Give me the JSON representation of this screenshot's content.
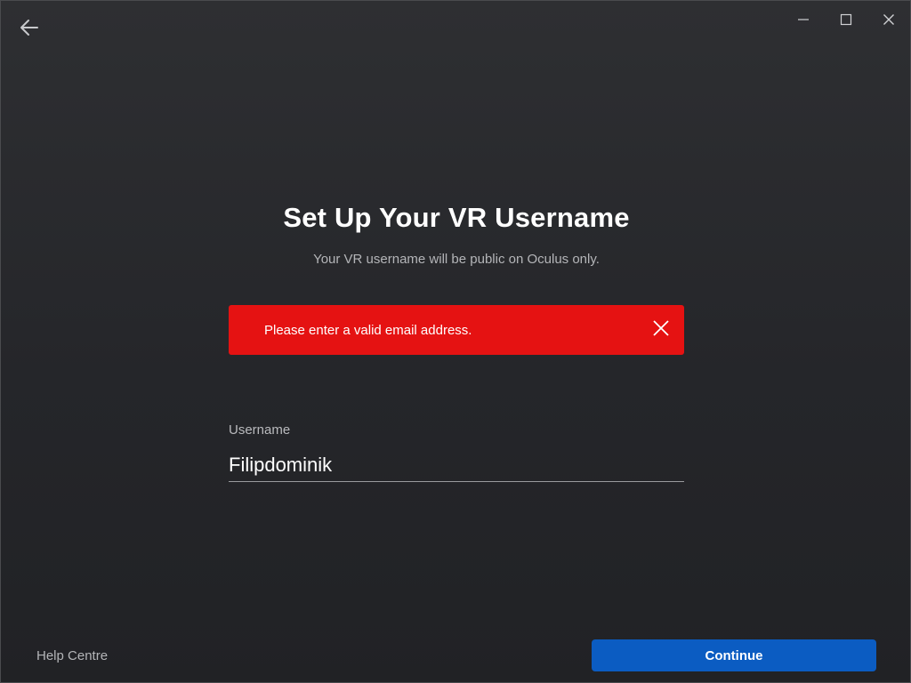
{
  "window": {
    "back_icon": "arrow-left-icon",
    "controls": [
      "minimize-icon",
      "maximize-icon",
      "close-icon"
    ]
  },
  "header": {
    "title": "Set Up Your VR Username",
    "subtitle": "Your VR username will be public on Oculus only."
  },
  "error": {
    "message": "Please enter a valid email address.",
    "color": "#e51212",
    "close_icon": "close-icon"
  },
  "form": {
    "username_label": "Username",
    "username_value": "Filipdominik"
  },
  "footer": {
    "help_label": "Help Centre",
    "continue_label": "Continue",
    "accent_color": "#0b5cc2"
  }
}
